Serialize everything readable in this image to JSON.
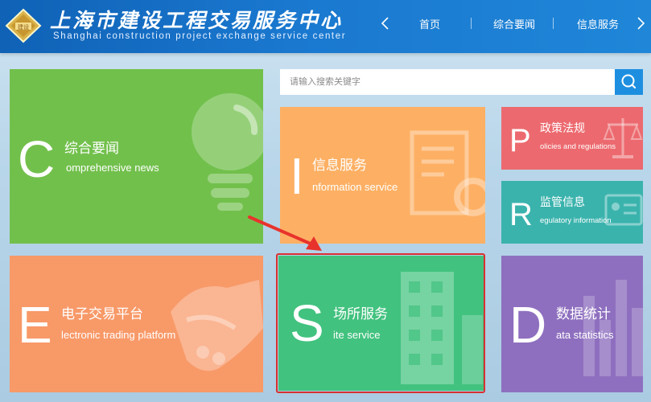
{
  "header": {
    "title_cn": "上海市建设工程交易服务中心",
    "title_en": "Shanghai construction project exchange service center",
    "logo_icon": "emblem-logo",
    "nav_items": [
      {
        "label": "首页"
      },
      {
        "label": "综合要闻"
      },
      {
        "label": "信息服务"
      }
    ]
  },
  "search": {
    "placeholder": "请输入搜索关键字",
    "button_icon": "search-icon"
  },
  "tiles": {
    "comprehensive": {
      "letter": "C",
      "cn": "综合要闻",
      "en": "omprehensive news",
      "color": "#72c04c",
      "icon": "lightbulb-icon"
    },
    "information": {
      "letter": "I",
      "cn": "信息服务",
      "en": "nformation service",
      "color": "#fdb064",
      "icon": "document-icon"
    },
    "policies": {
      "letter": "P",
      "cn": "政策法规",
      "en": "olicies and regulations",
      "color": "#ec6a6f",
      "icon": "scales-icon"
    },
    "regulatory": {
      "letter": "R",
      "cn": "监管信息",
      "en": "egulatory information",
      "color": "#3bb3ad",
      "icon": "id-card-icon"
    },
    "electronic": {
      "letter": "E",
      "cn": "电子交易平台",
      "en": "lectronic trading platform",
      "color": "#f89968",
      "icon": "handshake-icon"
    },
    "site": {
      "letter": "S",
      "cn": "场所服务",
      "en": "ite service",
      "color": "#42c27f",
      "icon": "building-icon"
    },
    "data": {
      "letter": "D",
      "cn": "数据统计",
      "en": "ata statistics",
      "color": "#8e6fbf",
      "icon": "bar-chart-icon"
    }
  },
  "annotation": {
    "highlight_color": "#d9302f",
    "arrow_color": "#e8332c"
  }
}
